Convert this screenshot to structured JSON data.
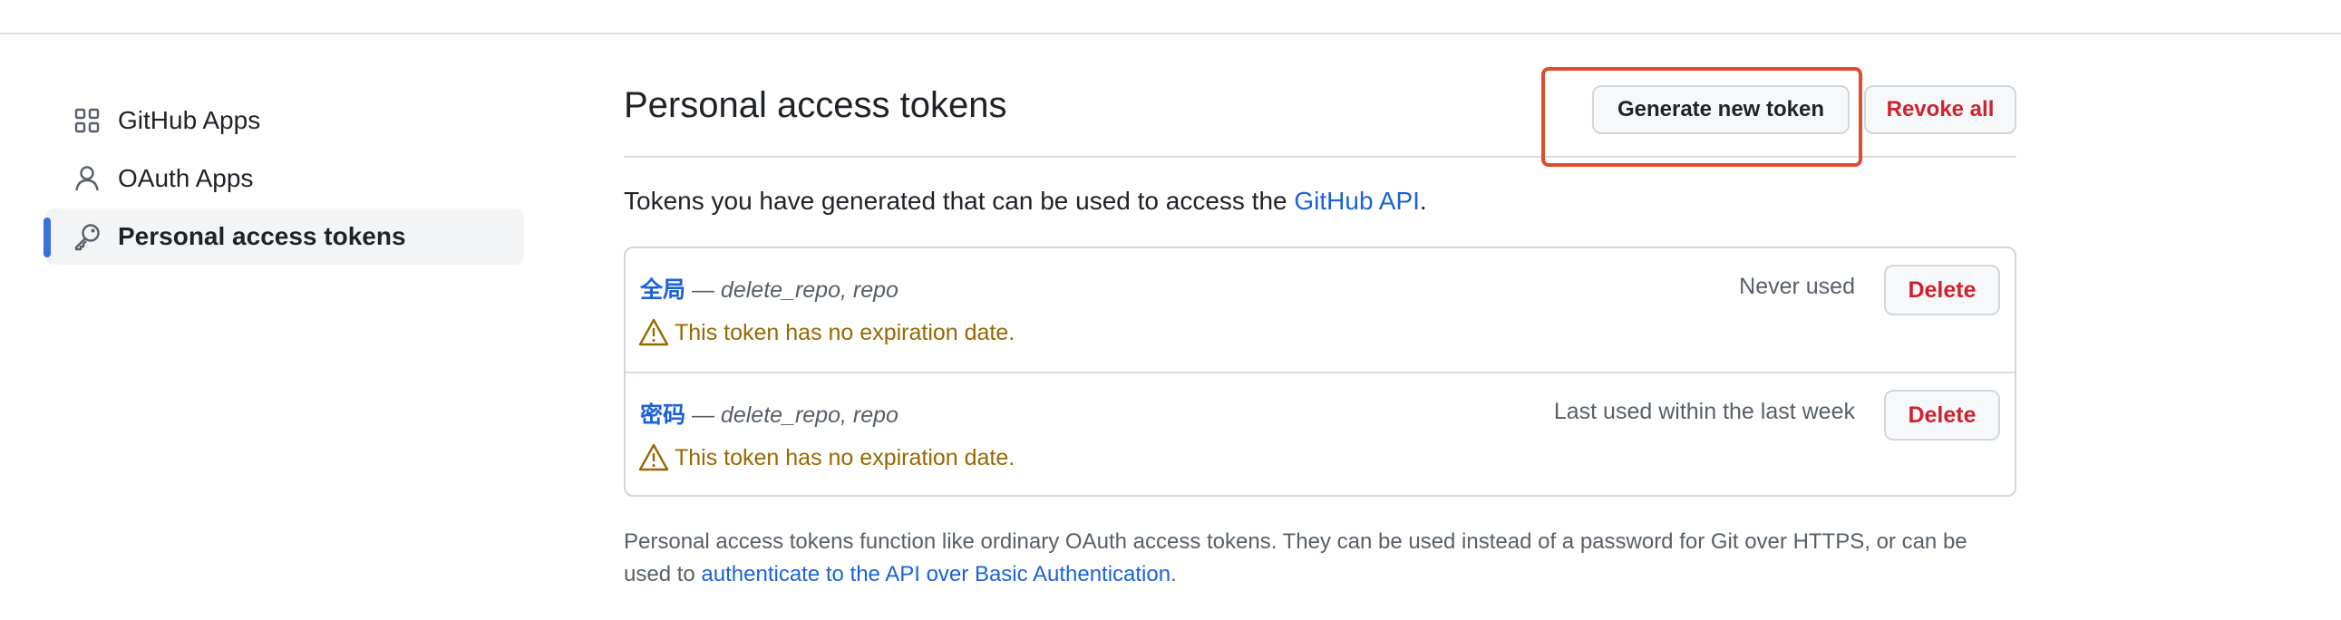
{
  "sidebar": {
    "items": [
      {
        "label": "GitHub Apps",
        "icon": "apps-grid-icon",
        "active": false
      },
      {
        "label": "OAuth Apps",
        "icon": "person-icon",
        "active": false
      },
      {
        "label": "Personal access tokens",
        "icon": "key-icon",
        "active": true
      }
    ]
  },
  "header": {
    "title": "Personal access tokens",
    "generate_label": "Generate new token",
    "revoke_label": "Revoke all"
  },
  "intro": {
    "text": "Tokens you have generated that can be used to access the ",
    "link": "GitHub API",
    "suffix": "."
  },
  "tokens": [
    {
      "name": "全局",
      "separator": " — ",
      "scopes": "delete_repo, repo",
      "warning": "This token has no expiration date.",
      "usage": "Never used",
      "delete_label": "Delete"
    },
    {
      "name": "密码",
      "separator": " — ",
      "scopes": "delete_repo, repo",
      "warning": "This token has no expiration date.",
      "usage": "Last used within the last week",
      "delete_label": "Delete"
    }
  ],
  "footnote": {
    "text": "Personal access tokens function like ordinary OAuth access tokens. They can be used instead of a password for Git over HTTPS, or can be used to ",
    "link": "authenticate to the API over Basic Authentication",
    "suffix": "."
  },
  "colors": {
    "accent": "#3b6fd9",
    "link": "#1c62d6",
    "danger": "#cf222e",
    "warning": "#9a6700",
    "highlight": "#e04a2e"
  }
}
